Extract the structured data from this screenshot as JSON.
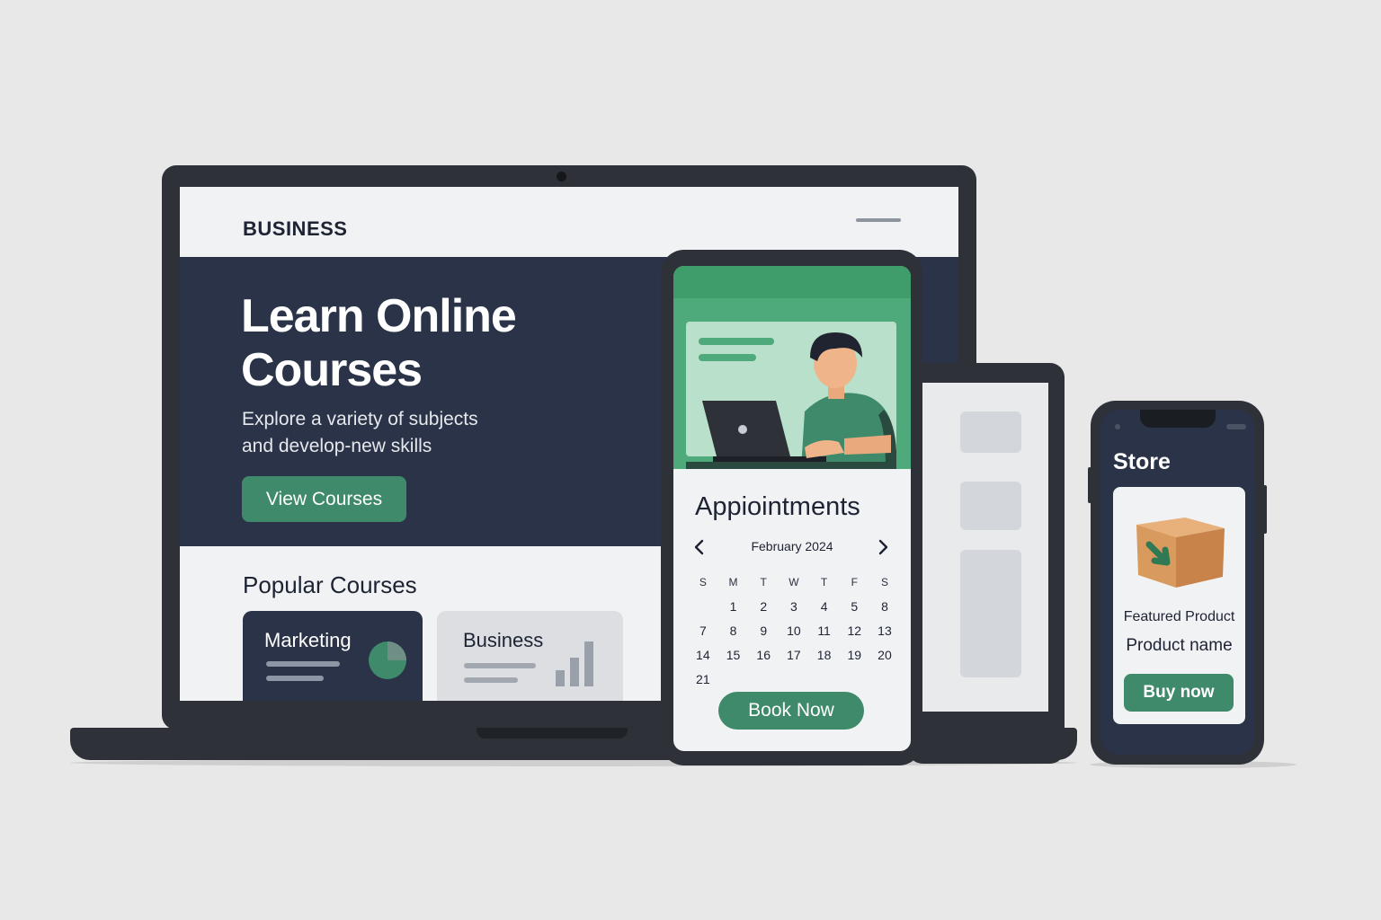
{
  "colors": {
    "background": "#e8e8e8",
    "device_frame": "#2e3238",
    "navy": "#2a3347",
    "accent_green": "#3e8a6a",
    "illustration_green": "#4eaa7a"
  },
  "laptop": {
    "brand": "BUSINESS",
    "menu_icon": "hamburger-icon",
    "hero": {
      "title": "Learn Online Courses",
      "subtitle_line1": "Explore a variety of subjects",
      "subtitle_line2": "and develop-new skills",
      "cta_label": "View Courses"
    },
    "popular": {
      "heading": "Popular Courses",
      "courses": [
        {
          "name": "Marketing",
          "icon": "pie-chart-icon"
        },
        {
          "name": "Business",
          "icon": "bar-chart-icon"
        }
      ]
    }
  },
  "appointments_phone": {
    "illustration": "person-with-laptop-illustration",
    "title": "Appiointments",
    "month": "February 2024",
    "prev_icon": "chevron-left-icon",
    "next_icon": "chevron-right-icon",
    "weekdays": [
      "S",
      "M",
      "T",
      "W",
      "T",
      "F",
      "S"
    ],
    "weeks": [
      [
        "",
        "1",
        "2",
        "3",
        "4",
        "5",
        "8"
      ],
      [
        "7",
        "8",
        "9",
        "10",
        "11",
        "12",
        "13"
      ],
      [
        "14",
        "15",
        "16",
        "17",
        "18",
        "19",
        "20"
      ],
      [
        "21",
        "",
        "",
        "",
        "",
        "",
        ""
      ]
    ],
    "book_label": "Book Now"
  },
  "store_phone": {
    "title": "Store",
    "product_icon": "package-box-icon",
    "featured_label": "Featured Product",
    "product_name": "Product name",
    "buy_label": "Buy now"
  }
}
